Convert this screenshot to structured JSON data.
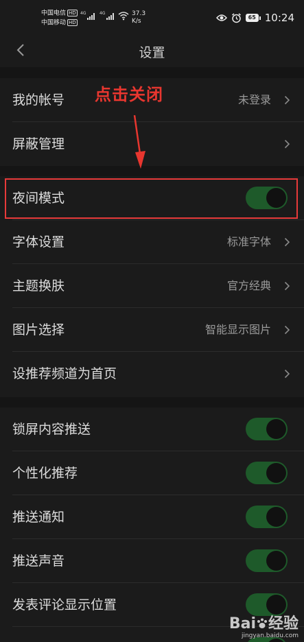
{
  "status_bar": {
    "carrier1": "中国电信",
    "carrier2": "中国移动",
    "hd_badge": "HD",
    "net1": "4G",
    "net2": "4G",
    "speed_value": "37.3",
    "speed_unit": "K/s",
    "battery": "65",
    "time": "10:24"
  },
  "header": {
    "title": "设置"
  },
  "groups": [
    {
      "items": [
        {
          "label": "我的帐号",
          "value": "未登录",
          "has_chevron": true
        },
        {
          "label": "屏蔽管理",
          "value": "",
          "has_chevron": true
        }
      ]
    },
    {
      "items": [
        {
          "label": "夜间模式",
          "toggle": true
        },
        {
          "label": "字体设置",
          "value": "标准字体",
          "has_chevron": true
        },
        {
          "label": "主题换肤",
          "value": "官方经典",
          "has_chevron": true
        },
        {
          "label": "图片选择",
          "value": "智能显示图片",
          "has_chevron": true
        },
        {
          "label": "设推荐频道为首页",
          "value": "",
          "has_chevron": true
        }
      ]
    },
    {
      "items": [
        {
          "label": "锁屏内容推送",
          "toggle": true
        },
        {
          "label": "个性化推荐",
          "toggle": true
        },
        {
          "label": "推送通知",
          "toggle": true
        },
        {
          "label": "推送声音",
          "toggle": true
        },
        {
          "label": "发表评论显示位置",
          "toggle": true
        }
      ]
    }
  ],
  "annotation": {
    "callout": "点击关闭",
    "color": "#e8362f"
  },
  "watermark": {
    "brand_left": "Bai",
    "brand_right": "经验",
    "url": "jingyan.baidu.com"
  },
  "colors": {
    "background": "#151515",
    "row_background": "#1b1b1b",
    "toggle_on": "#1e5a2a"
  }
}
